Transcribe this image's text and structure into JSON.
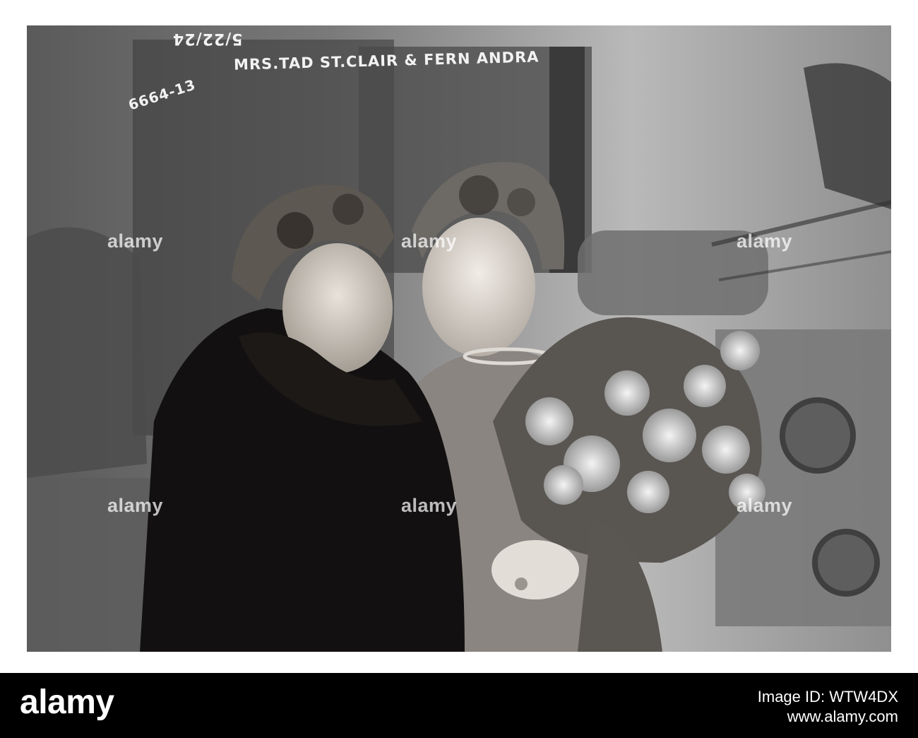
{
  "photo": {
    "caption": "MRS.TAD ST.CLAIR & FERN ANDRA",
    "date_note": "5/22/24",
    "negative_number": "6664-13",
    "watermark_text": "alamy"
  },
  "footer": {
    "brand": "alamy",
    "image_id_label": "Image ID: WTW4DX",
    "site": "www.alamy.com"
  },
  "colors": {
    "frame": "#0b0b0b",
    "footer_bg": "#000000",
    "page_bg": "#ffffff"
  }
}
